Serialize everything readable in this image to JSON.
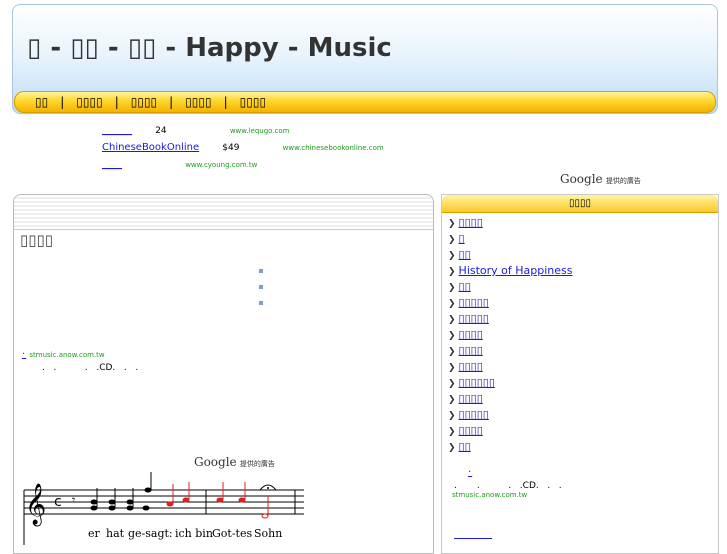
{
  "header": {
    "title": "▯ - ▯▯ - ▯▯ - Happy - Music",
    "nav": [
      "▯▯",
      "▯▯▯▯",
      "▯▯▯▯",
      "▯▯▯▯",
      "▯▯▯▯"
    ],
    "nav_seps": [
      "|",
      "|",
      "|",
      "|"
    ]
  },
  "top_ads": [
    {
      "title": "______",
      "price": "24",
      "url": "www.lequgo.com"
    },
    {
      "title": "ChineseBookOnline",
      "price": "$49",
      "url": "www.chinesebookonline.com"
    },
    {
      "title": "____",
      "url": "www.cyoung.com.tw"
    }
  ],
  "google_ads_label": {
    "brand": "Google",
    "text": "提供的廣告"
  },
  "main": {
    "heading": "▯▯▯▯",
    "ad": {
      "title": "·",
      "url": "stmusic.anow.com.tw",
      "desc": ".   .          .   .CD.   .   ."
    }
  },
  "sidebar": {
    "heading": "▯▯▯▯",
    "items": [
      "▯▯▯▯",
      "▯",
      "▯▯",
      "History of Happiness",
      "▯▯",
      "▯▯▯▯▯",
      "▯▯▯▯▯",
      "▯▯▯▯",
      "▯▯▯▯",
      "▯▯▯▯",
      "▯▯▯▯▯▯",
      "▯▯▯▯",
      "▯▯▯▯▯",
      "▯▯▯▯",
      "▯▯"
    ],
    "ad": {
      "title": "·",
      "desc": ".       .          .   .CD.   .   .",
      "url": "stmusic.anow.com.tw"
    }
  },
  "score": {
    "lyrics": [
      "er",
      "hat",
      "ge-sagt:",
      "ich bin",
      "Got-tes",
      "Sohn"
    ]
  },
  "colors": {
    "link": "#1a1ad8",
    "ad_url": "#1f9a1f",
    "nav_gold": "#fed52d"
  }
}
